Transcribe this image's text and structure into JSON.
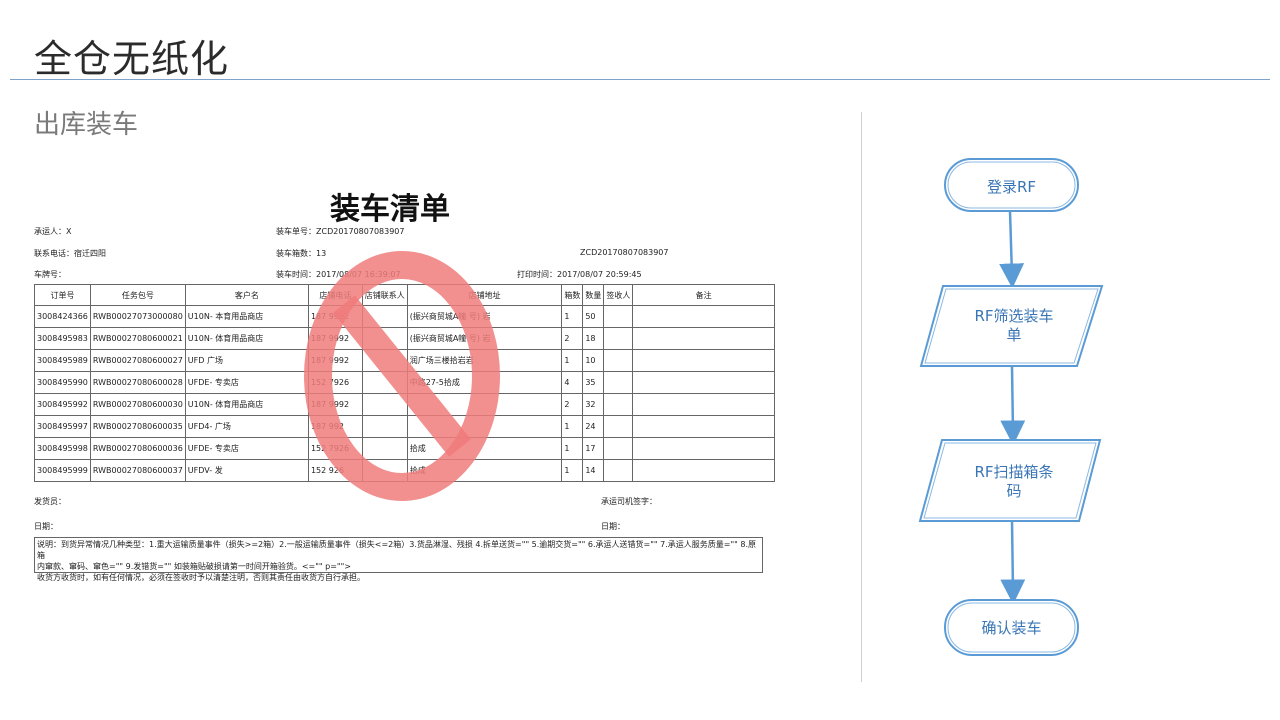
{
  "slide": {
    "title": "全仓无纸化",
    "section": "出库装车"
  },
  "document": {
    "title": "装车清单",
    "carrier_label": "承运人：X",
    "phone_label": "联系电话：宿迁四阳",
    "plate_label": "车牌号：",
    "load_no_label": "装车单号：ZCD20170807083907",
    "box_count_label": "装车箱数：13",
    "load_time_label": "装车时间：2017/08/07 16:39:07",
    "barcode_text": "ZCD20170807083907",
    "print_time_label": "打印时间：2017/08/07 20:59:45",
    "columns": [
      "订单号",
      "任务包号",
      "客户名",
      "店铺电话",
      "店铺联系人",
      "店铺地址",
      "箱数",
      "数量",
      "签收人",
      "备注"
    ],
    "rows": [
      [
        "3008424366",
        "RWB00027073000080",
        "U10N-        本育用品商店",
        "187      9992",
        "",
        "       (振兴商贸城A幢  号) 岩",
        "1",
        "50",
        "",
        ""
      ],
      [
        "3008495983",
        "RWB00027080600021",
        "U10N-       体育用品商店",
        "187      9992",
        "",
        "       (振兴商贸城A幢  号) 岩",
        "2",
        "18",
        "",
        ""
      ],
      [
        "3008495989",
        "RWB00027080600027",
        "UFD         广场",
        "187     9992",
        "",
        "        润广场三楼拾岩岩",
        "1",
        "10",
        "",
        ""
      ],
      [
        "3008495990",
        "RWB00027080600028",
        "UFDE-         专卖店",
        "152      7926",
        "",
        "         中路27-5拾成",
        "4",
        "35",
        "",
        ""
      ],
      [
        "3008495992",
        "RWB00027080600030",
        "U10N-      体育用品商店",
        "187      9992",
        "",
        "",
        "2",
        "32",
        "",
        ""
      ],
      [
        "3008495997",
        "RWB00027080600035",
        "UFD4-      广场",
        "187      992",
        "",
        "",
        "1",
        "24",
        "",
        ""
      ],
      [
        "3008495998",
        "RWB00027080600036",
        "UFDE-        专卖店",
        "152      7926",
        "",
        "             拾成",
        "1",
        "17",
        "",
        ""
      ],
      [
        "3008495999",
        "RWB00027080600037",
        "UFDV-        发",
        "152      926",
        "",
        "             拾成",
        "1",
        "14",
        "",
        ""
      ]
    ],
    "shipper_label": "发货员：",
    "driver_sign_label": "承运司机签字：",
    "date_left_label": "日期：",
    "date_right_label": "日期：",
    "notes_line1": "说明：到货异常情况几种类型：1.重大运输质量事件（损失>=2箱）2.一般运输质量事件（损失<=2箱）3.货品淋湿、残损 4.拆单送货=\"\" 5.逾期交货=\"\" 6.承运人送错货=\"\" 7.承运人服务质量=\"\" 8.原箱",
    "notes_line2": "内窜款、窜码、窜色=\"\" 9.发错货=\"\" 如装箱贴破损请第一时间开箱验货。<=\"\" p=\"\">",
    "notes_line3": "收货方收货时，如有任何情况，必须在签收时予以清楚注明，否则其责任由收货方自行承担。",
    "stamp_color": "#f07c7c"
  },
  "flow": {
    "steps": [
      "登录RF",
      "RF筛选装车单",
      "RF扫描箱条码",
      "确认装车"
    ],
    "step2_line1": "RF筛选装车",
    "step2_line2": "单",
    "step3_line1": "RF扫描箱条",
    "step3_line2": "码",
    "stroke_color": "#5b9bd5",
    "text_color": "#3a76b6"
  }
}
